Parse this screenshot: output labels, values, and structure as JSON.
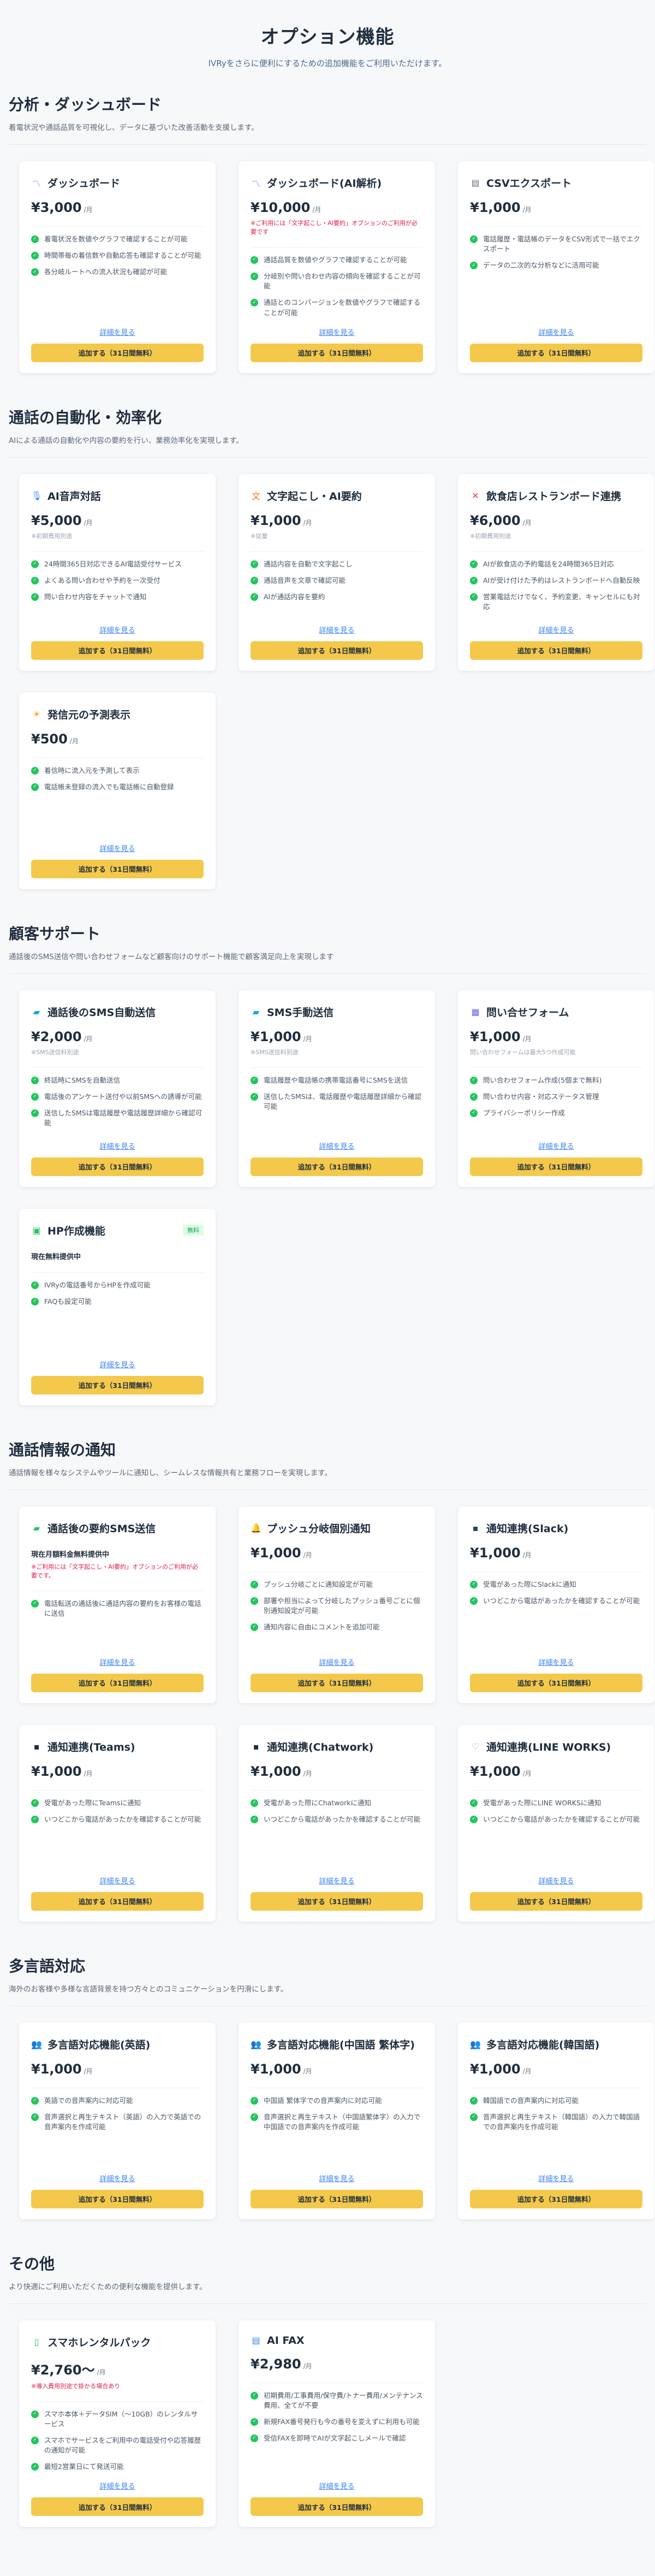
{
  "hero": {
    "title": "オプション機能",
    "subtitle": "IVRyをさらに便利にするための追加機能をご利用いただけます。"
  },
  "common": {
    "detail_link": "詳細を見る",
    "add_button": "追加する（31日間無料）"
  },
  "sections": [
    {
      "title": "分析・ダッシュボード",
      "desc": "着電状況や通話品質を可視化し、データに基づいた改善活動を支援します。",
      "cards": [
        {
          "icon": "chart-icon",
          "icon_char": "〽",
          "icon_color": "#8b5cf6",
          "title": "ダッシュボード",
          "price": "¥3,000",
          "unit": "/月",
          "sub": "",
          "features": [
            "着電状況を数値やグラフで確認することが可能",
            "時間帯毎の着信数や自動応答も確認することが可能",
            "各分岐ルートへの流入状況も確認が可能"
          ]
        },
        {
          "icon": "chart-icon",
          "icon_char": "〽",
          "icon_color": "#8b5cf6",
          "title": "ダッシュボード(AI解析)",
          "price": "¥10,000",
          "unit": "/月",
          "sub": "※ご利用には「文字起こし・AI要約」オプションのご利用が必要です",
          "sub_style": "red",
          "features": [
            "通話品質を数値やグラフで確認することが可能",
            "分岐別や問い合わせ内容の傾向を確認することが可能",
            "通話とのコンバージョンを数値やグラフで確認することが可能"
          ]
        },
        {
          "icon": "file-icon",
          "icon_char": "▤",
          "icon_color": "#6b7280",
          "title": "CSVエクスポート",
          "price": "¥1,000",
          "unit": "/月",
          "sub": "",
          "features": [
            "電話履歴・電話帳のデータをCSV形式で一括でエクスポート",
            "データの二次的な分析などに活用可能"
          ]
        }
      ]
    },
    {
      "title": "通話の自動化・効率化",
      "desc": "AIによる通話の自動化や内容の要約を行い、業務効率化を実現します。",
      "cards": [
        {
          "icon": "microphone-icon",
          "icon_char": "🎙",
          "icon_color": "#3b82f6",
          "title": "AI音声対話",
          "price": "¥5,000",
          "unit": "/月",
          "sub": "※初期費用別途",
          "features": [
            "24時間365日対応できるAI電話受付サービス",
            "よくある問い合わせや予約を一次受付",
            "問い合わせ内容をチャットで通知"
          ]
        },
        {
          "icon": "translate-icon",
          "icon_char": "文",
          "icon_color": "#f97316",
          "title": "文字起こし・AI要約",
          "price": "¥1,000",
          "unit": "/月",
          "sub": "※従量",
          "features": [
            "通話内容を自動で文字起こし",
            "通話音声を文章で確認可能",
            "AIが通話内容を要約"
          ]
        },
        {
          "icon": "restaurant-icon",
          "icon_char": "✕",
          "icon_color": "#ef4444",
          "title": "飲食店レストランボード連携",
          "price": "¥6,000",
          "unit": "/月",
          "sub": "※初期費用別途",
          "features": [
            "AIが飲食店の予約電話を24時間365日対応",
            "AIが受け付けた予約はレストランボードへ自動反映",
            "営業電話だけでなく、予約変更、キャンセルにも対応"
          ]
        },
        {
          "icon": "forecast-icon",
          "icon_char": "☀",
          "icon_color": "#f59e0b",
          "title": "発信元の予測表示",
          "price": "¥500",
          "unit": "/月",
          "sub": "",
          "features": [
            "着信時に流入元を予測して表示",
            "電話帳未登録の流入でも電話帳に自動登録"
          ]
        }
      ]
    },
    {
      "title": "顧客サポート",
      "desc": "通話後のSMS送信や問い合わせフォームなど顧客向けのサポート機能で顧客満足向上を実現します",
      "cards": [
        {
          "icon": "message-icon",
          "icon_char": "▰",
          "icon_color": "#0ea5e9",
          "title": "通話後のSMS自動送信",
          "price": "¥2,000",
          "unit": "/月",
          "sub": "※SMS送信料別途",
          "features": [
            "終話時にSMSを自動送信",
            "電話後のアンケート送付や以前SMSへの誘導が可能",
            "送信したSMSは電話履歴や電話履歴詳細から確認可能"
          ]
        },
        {
          "icon": "message-icon",
          "icon_char": "▰",
          "icon_color": "#0ea5e9",
          "title": "SMS手動送信",
          "price": "¥1,000",
          "unit": "/月",
          "sub": "※SMS送信料別途",
          "features": [
            "電話履歴や電話帳の携帯電話番号にSMSを送信",
            "送信したSMSは、電話履歴や電話履歴詳細から確認可能"
          ]
        },
        {
          "icon": "form-icon",
          "icon_char": "▦",
          "icon_color": "#6366f1",
          "title": "問い合せフォーム",
          "price": "¥1,000",
          "unit": "/月",
          "sub": "問い合わせフォームは最大5つ作成可能",
          "features": [
            "問い合わせフォーム作成(5個まで無料)",
            "問い合わせ内容・対応ステータス管理",
            "プライバシーポリシー作成"
          ]
        },
        {
          "icon": "web-icon",
          "icon_char": "▣",
          "icon_color": "#22c55e",
          "title": "HP作成機能",
          "badge": "無料",
          "price": "",
          "unit": "",
          "sub": "現在無料提供中",
          "sub_style": "strong",
          "features": [
            "IVRyの電話番号からHPを作成可能",
            "FAQも設定可能"
          ]
        }
      ]
    },
    {
      "title": "通話情報の通知",
      "desc": "通話情報を様々なシステムやツールに通知し、シームレスな情報共有と業務フローを実現します。",
      "cards": [
        {
          "icon": "message-icon",
          "icon_char": "▰",
          "icon_color": "#22c55e",
          "title": "通話後の要約SMS送信",
          "price": "",
          "unit": "",
          "sub": "現在月額料金無料提供中",
          "sub_style": "strong",
          "sub2": "※ご利用には「文字起こし・AI要約」オプションのご利用が必要です。",
          "features": [
            "電話転送の通話後に通話内容の要約をお客様の電話に送信"
          ]
        },
        {
          "icon": "bell-icon",
          "icon_char": "🔔",
          "icon_color": "#ef4444",
          "title": "プッシュ分岐個別通知",
          "price": "¥1,000",
          "unit": "/月",
          "sub": "",
          "features": [
            "プッシュ分岐ごとに通知設定が可能",
            "部署や担当によって分岐したプッシュ番号ごとに個別通知設定が可能",
            "通知内容に自由にコメントを追加可能"
          ]
        },
        {
          "icon": "slack-icon",
          "icon_char": "▪",
          "icon_color": "#1f4d59",
          "title": "通知連携(Slack)",
          "price": "¥1,000",
          "unit": "/月",
          "sub": "",
          "features": [
            "受電があった際にSlackに通知",
            "いつどこから電話があったかを確認することが可能"
          ]
        },
        {
          "icon": "teams-icon",
          "icon_char": "▪",
          "icon_color": "#1f2d3d",
          "title": "通知連携(Teams)",
          "price": "¥1,000",
          "unit": "/月",
          "sub": "",
          "features": [
            "受電があった際にTeamsに通知",
            "いつどこから電話があったかを確認することが可能"
          ]
        },
        {
          "icon": "chatwork-icon",
          "icon_char": "▪",
          "icon_color": "#1f2d3d",
          "title": "通知連携(Chatwork)",
          "price": "¥1,000",
          "unit": "/月",
          "sub": "",
          "features": [
            "受電があった際にChatworkに通知",
            "いつどこから電話があったかを確認することが可能"
          ]
        },
        {
          "icon": "lineworks-icon",
          "icon_char": "♡",
          "icon_color": "#9ca3af",
          "title": "通知連携(LINE WORKS)",
          "price": "¥1,000",
          "unit": "/月",
          "sub": "",
          "features": [
            "受電があった際にLINE WORKSに通知",
            "いつどこから電話があったかを確認することが可能"
          ]
        }
      ]
    },
    {
      "title": "多言語対応",
      "desc": "海外のお客様や多様な言語背景を持つ方々とのコミュニケーションを円滑にします。",
      "cards": [
        {
          "icon": "users-icon",
          "icon_char": "👥",
          "icon_color": "#ec4899",
          "title": "多言語対応機能(英語)",
          "price": "¥1,000",
          "unit": "/月",
          "sub": "",
          "features": [
            "英語での音声案内に対応可能",
            "音声選択と再生テキスト（英語）の入力で英語での音声案内を作成可能"
          ]
        },
        {
          "icon": "users-icon",
          "icon_char": "👥",
          "icon_color": "#ec4899",
          "title": "多言語対応機能(中国語 繁体字)",
          "price": "¥1,000",
          "unit": "/月",
          "sub": "",
          "features": [
            "中国語 繁体字での音声案内に対応可能",
            "音声選択と再生テキスト（中国語繁体字）の入力で中国語での音声案内を作成可能"
          ]
        },
        {
          "icon": "users-icon",
          "icon_char": "👥",
          "icon_color": "#ec4899",
          "title": "多言語対応機能(韓国語)",
          "price": "¥1,000",
          "unit": "/月",
          "sub": "",
          "features": [
            "韓国語での音声案内に対応可能",
            "音声選択と再生テキスト（韓国語）の入力で韓国語での音声案内を作成可能"
          ]
        }
      ]
    },
    {
      "title": "その他",
      "desc": "より快適にご利用いただくための便利な機能を提供します。",
      "cards": [
        {
          "icon": "smartphone-icon",
          "icon_char": "▯",
          "icon_color": "#22c55e",
          "title": "スマホレンタルパック",
          "price": "¥2,760〜",
          "unit": "/月",
          "sub": "※導入費用別途で掛かる場合あり",
          "sub_style": "red",
          "features": [
            "スマホ本体＋データSIM（〜10GB）のレンタルサービス",
            "スマホでサービスをご利用中の電話受付や応答履歴の通知が可能",
            "最短2営業日にて発送可能"
          ]
        },
        {
          "icon": "fax-icon",
          "icon_char": "▤",
          "icon_color": "#3b82f6",
          "title": "AI FAX",
          "price": "¥2,980",
          "unit": "/月",
          "sub": "",
          "features": [
            "初期費用/工事費用/保守費/トナー費用/メンテナンス費用、全てが不要",
            "新規FAX番号発行も今の番号を変えずに利用も可能",
            "受信FAXを即時でAIが文字起こしメールで確認"
          ]
        }
      ]
    }
  ]
}
